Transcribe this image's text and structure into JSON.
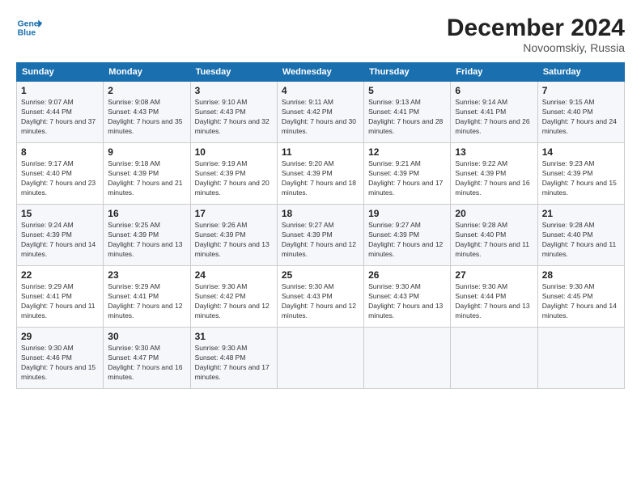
{
  "header": {
    "logo_line1": "General",
    "logo_line2": "Blue",
    "title": "December 2024",
    "location": "Novoomskiy, Russia"
  },
  "days_of_week": [
    "Sunday",
    "Monday",
    "Tuesday",
    "Wednesday",
    "Thursday",
    "Friday",
    "Saturday"
  ],
  "weeks": [
    [
      {
        "day": "1",
        "sunrise": "9:07 AM",
        "sunset": "4:44 PM",
        "daylight": "7 hours and 37 minutes."
      },
      {
        "day": "2",
        "sunrise": "9:08 AM",
        "sunset": "4:43 PM",
        "daylight": "7 hours and 35 minutes."
      },
      {
        "day": "3",
        "sunrise": "9:10 AM",
        "sunset": "4:43 PM",
        "daylight": "7 hours and 32 minutes."
      },
      {
        "day": "4",
        "sunrise": "9:11 AM",
        "sunset": "4:42 PM",
        "daylight": "7 hours and 30 minutes."
      },
      {
        "day": "5",
        "sunrise": "9:13 AM",
        "sunset": "4:41 PM",
        "daylight": "7 hours and 28 minutes."
      },
      {
        "day": "6",
        "sunrise": "9:14 AM",
        "sunset": "4:41 PM",
        "daylight": "7 hours and 26 minutes."
      },
      {
        "day": "7",
        "sunrise": "9:15 AM",
        "sunset": "4:40 PM",
        "daylight": "7 hours and 24 minutes."
      }
    ],
    [
      {
        "day": "8",
        "sunrise": "9:17 AM",
        "sunset": "4:40 PM",
        "daylight": "7 hours and 23 minutes."
      },
      {
        "day": "9",
        "sunrise": "9:18 AM",
        "sunset": "4:39 PM",
        "daylight": "7 hours and 21 minutes."
      },
      {
        "day": "10",
        "sunrise": "9:19 AM",
        "sunset": "4:39 PM",
        "daylight": "7 hours and 20 minutes."
      },
      {
        "day": "11",
        "sunrise": "9:20 AM",
        "sunset": "4:39 PM",
        "daylight": "7 hours and 18 minutes."
      },
      {
        "day": "12",
        "sunrise": "9:21 AM",
        "sunset": "4:39 PM",
        "daylight": "7 hours and 17 minutes."
      },
      {
        "day": "13",
        "sunrise": "9:22 AM",
        "sunset": "4:39 PM",
        "daylight": "7 hours and 16 minutes."
      },
      {
        "day": "14",
        "sunrise": "9:23 AM",
        "sunset": "4:39 PM",
        "daylight": "7 hours and 15 minutes."
      }
    ],
    [
      {
        "day": "15",
        "sunrise": "9:24 AM",
        "sunset": "4:39 PM",
        "daylight": "7 hours and 14 minutes."
      },
      {
        "day": "16",
        "sunrise": "9:25 AM",
        "sunset": "4:39 PM",
        "daylight": "7 hours and 13 minutes."
      },
      {
        "day": "17",
        "sunrise": "9:26 AM",
        "sunset": "4:39 PM",
        "daylight": "7 hours and 13 minutes."
      },
      {
        "day": "18",
        "sunrise": "9:27 AM",
        "sunset": "4:39 PM",
        "daylight": "7 hours and 12 minutes."
      },
      {
        "day": "19",
        "sunrise": "9:27 AM",
        "sunset": "4:39 PM",
        "daylight": "7 hours and 12 minutes."
      },
      {
        "day": "20",
        "sunrise": "9:28 AM",
        "sunset": "4:40 PM",
        "daylight": "7 hours and 11 minutes."
      },
      {
        "day": "21",
        "sunrise": "9:28 AM",
        "sunset": "4:40 PM",
        "daylight": "7 hours and 11 minutes."
      }
    ],
    [
      {
        "day": "22",
        "sunrise": "9:29 AM",
        "sunset": "4:41 PM",
        "daylight": "7 hours and 11 minutes."
      },
      {
        "day": "23",
        "sunrise": "9:29 AM",
        "sunset": "4:41 PM",
        "daylight": "7 hours and 12 minutes."
      },
      {
        "day": "24",
        "sunrise": "9:30 AM",
        "sunset": "4:42 PM",
        "daylight": "7 hours and 12 minutes."
      },
      {
        "day": "25",
        "sunrise": "9:30 AM",
        "sunset": "4:43 PM",
        "daylight": "7 hours and 12 minutes."
      },
      {
        "day": "26",
        "sunrise": "9:30 AM",
        "sunset": "4:43 PM",
        "daylight": "7 hours and 13 minutes."
      },
      {
        "day": "27",
        "sunrise": "9:30 AM",
        "sunset": "4:44 PM",
        "daylight": "7 hours and 13 minutes."
      },
      {
        "day": "28",
        "sunrise": "9:30 AM",
        "sunset": "4:45 PM",
        "daylight": "7 hours and 14 minutes."
      }
    ],
    [
      {
        "day": "29",
        "sunrise": "9:30 AM",
        "sunset": "4:46 PM",
        "daylight": "7 hours and 15 minutes."
      },
      {
        "day": "30",
        "sunrise": "9:30 AM",
        "sunset": "4:47 PM",
        "daylight": "7 hours and 16 minutes."
      },
      {
        "day": "31",
        "sunrise": "9:30 AM",
        "sunset": "4:48 PM",
        "daylight": "7 hours and 17 minutes."
      },
      null,
      null,
      null,
      null
    ]
  ]
}
